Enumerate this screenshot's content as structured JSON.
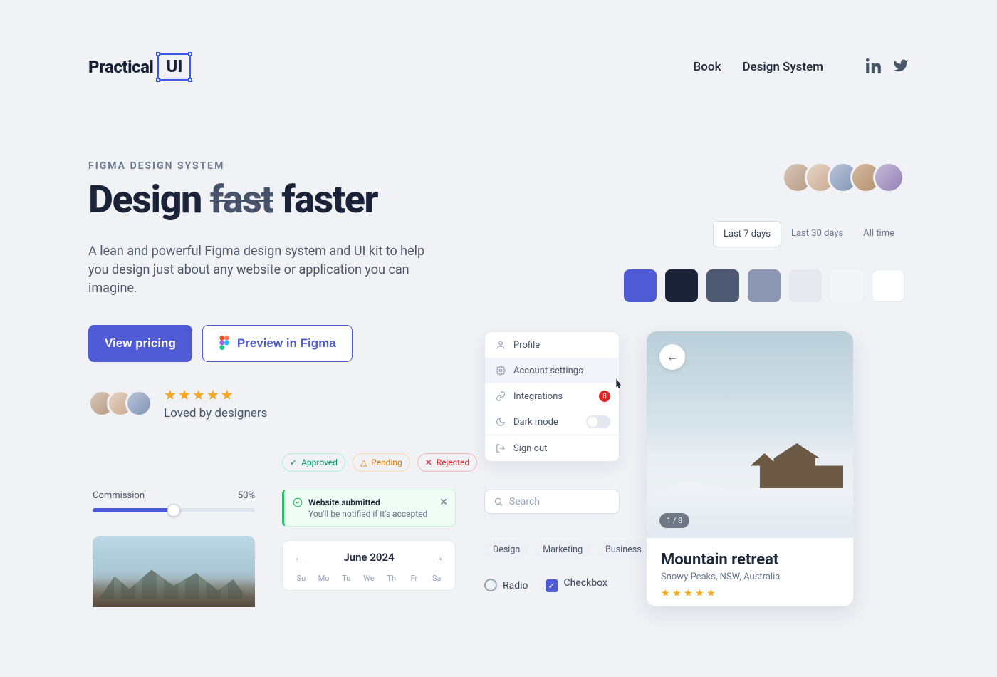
{
  "header": {
    "logo_text": "Practical",
    "logo_ui": "UI",
    "nav": {
      "book": "Book",
      "design_system": "Design System"
    }
  },
  "hero": {
    "eyebrow": "FIGMA DESIGN SYSTEM",
    "title_pre": "Design ",
    "title_strike": "fast",
    "title_post": " faster",
    "subtext": "A lean and powerful Figma design system and UI kit to help you design just about any website or application you can imagine.",
    "cta_primary": "View pricing",
    "cta_secondary": "Preview in Figma",
    "loved": "Loved by designers"
  },
  "segmented": {
    "items": [
      "Last 7 days",
      "Last 30 days",
      "All time"
    ],
    "active_index": 0
  },
  "swatches": [
    "#4f5bd5",
    "#1a2338",
    "#4e5a74",
    "#8a96b2",
    "#e6e9f0",
    "#f4f5f8",
    "#ffffff"
  ],
  "menu": {
    "profile": "Profile",
    "account": "Account settings",
    "integrations": "Integrations",
    "integrations_badge": "8",
    "dark_mode": "Dark mode",
    "sign_out": "Sign out"
  },
  "search": {
    "placeholder": "Search"
  },
  "chips": [
    "Design",
    "Marketing",
    "Business"
  ],
  "form": {
    "radio": "Radio",
    "checkbox": "Checkbox"
  },
  "status": {
    "approved": "Approved",
    "pending": "Pending",
    "rejected": "Rejected"
  },
  "slider": {
    "label": "Commission",
    "value": "50%"
  },
  "toast": {
    "title": "Website submitted",
    "sub": "You'll be notified if it's accepted"
  },
  "calendar": {
    "month": "June 2024",
    "days": [
      "Su",
      "Mo",
      "Tu",
      "We",
      "Th",
      "Fr",
      "Sa"
    ]
  },
  "retreat": {
    "count": "1 / 8",
    "title": "Mountain retreat",
    "location": "Snowy Peaks, NSW, Australia"
  }
}
